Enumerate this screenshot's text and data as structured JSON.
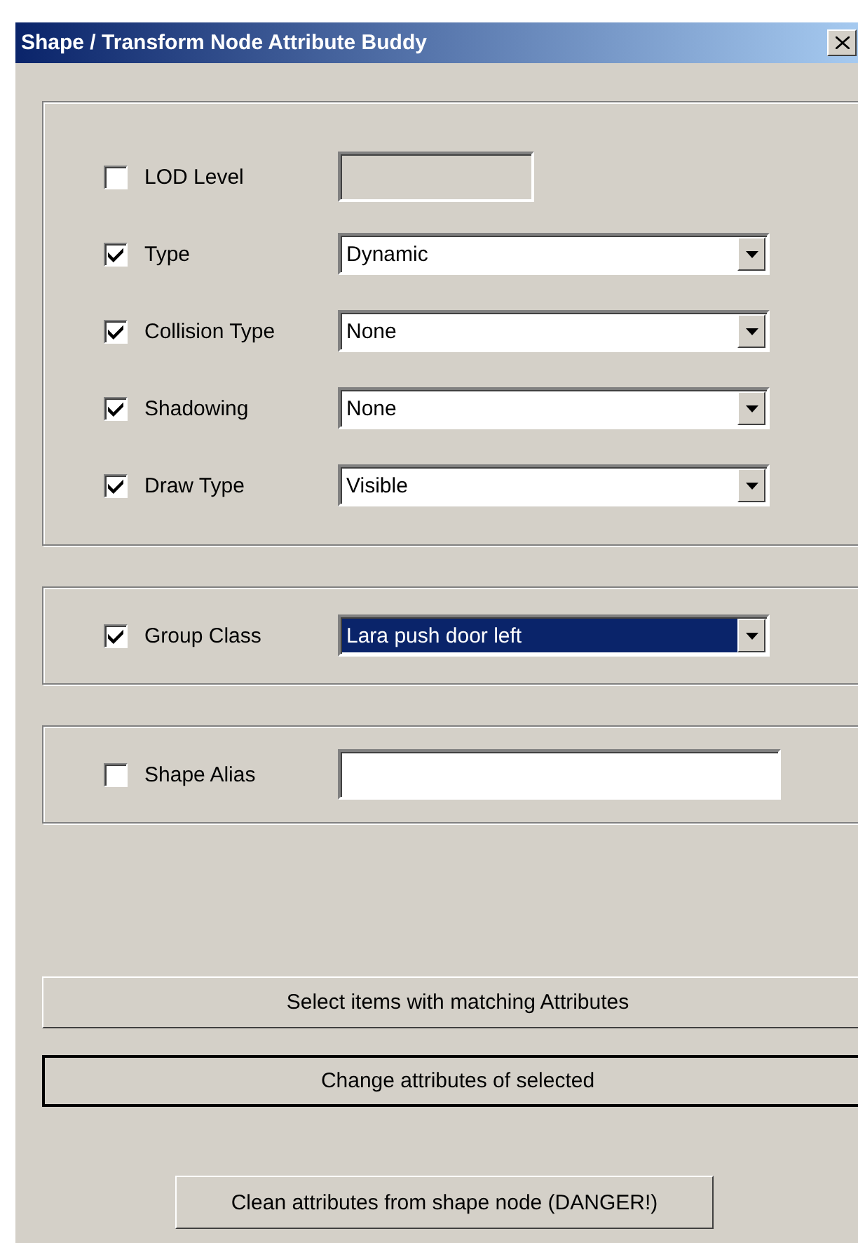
{
  "window": {
    "title": "Shape / Transform Node Attribute Buddy"
  },
  "groups": [
    {
      "rows": [
        {
          "label": "LOD Level",
          "checked": false,
          "kind": "text",
          "value": "",
          "enabled": false
        },
        {
          "label": "Type",
          "checked": true,
          "kind": "dropdown",
          "value": "Dynamic",
          "focused": false
        },
        {
          "label": "Collision Type",
          "checked": true,
          "kind": "dropdown",
          "value": "None",
          "focused": false
        },
        {
          "label": "Shadowing",
          "checked": true,
          "kind": "dropdown",
          "value": "None",
          "focused": false
        },
        {
          "label": "Draw Type",
          "checked": true,
          "kind": "dropdown",
          "value": "Visible",
          "focused": false
        }
      ]
    },
    {
      "rows": [
        {
          "label": "Group Class",
          "checked": true,
          "kind": "dropdown",
          "value": "Lara push door left",
          "focused": true
        }
      ]
    },
    {
      "rows": [
        {
          "label": "Shape Alias",
          "checked": false,
          "kind": "text",
          "value": "",
          "enabled": true
        }
      ]
    }
  ],
  "buttons": [
    {
      "label": "Select items with matching Attributes",
      "default": false,
      "kind": "wide"
    },
    {
      "label": "Change attributes of selected",
      "default": true,
      "kind": "wide"
    },
    {
      "label": "Clean attributes from shape node (DANGER!)",
      "default": false,
      "kind": "compact"
    }
  ]
}
